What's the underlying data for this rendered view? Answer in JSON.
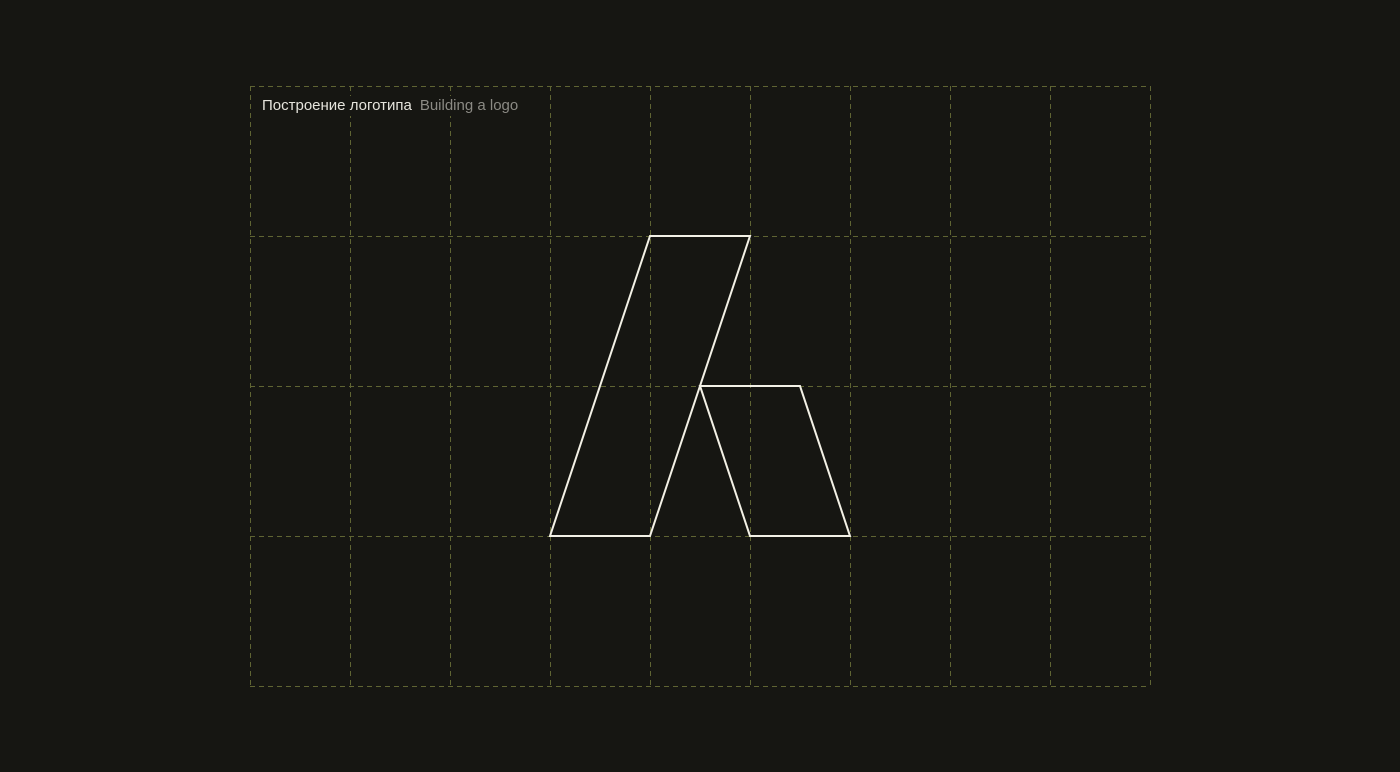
{
  "caption": {
    "russian": "Построение логотипа",
    "english": "Building a logo"
  },
  "colors": {
    "background": "#161612",
    "grid": "#5f6433",
    "logo_stroke": "#f3f1e6",
    "caption_primary": "#e6e4dc",
    "caption_secondary": "#8b8a84"
  }
}
